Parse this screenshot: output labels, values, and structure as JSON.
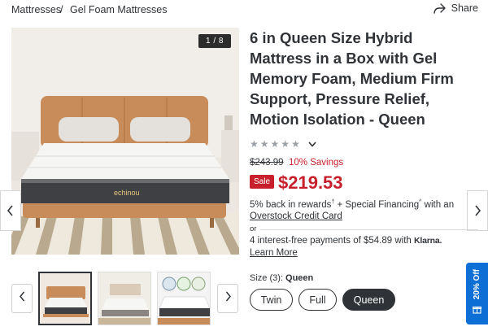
{
  "breadcrumb": {
    "items": [
      "Mattresses",
      "Gel Foam Mattresses"
    ],
    "separator": "/"
  },
  "share": {
    "label": "Share",
    "icon": "share-arrow-icon"
  },
  "gallery": {
    "counter": "1 / 8",
    "brand_mark": "echinou",
    "prev_icon": "chevron-left-icon",
    "next_icon": "chevron-right-icon"
  },
  "thumbnails": {
    "count_visible": 3,
    "selected_index": 0
  },
  "product": {
    "title": "6 in Queen Size Hybrid Mattress in a Box with Gel Memory Foam, Medium Firm Support, Pressure Relief, Motion Isolation - Queen",
    "rating_stars": 0,
    "was_price": "$243.99",
    "savings": "10% Savings",
    "sale_badge": "Sale",
    "price": "$219.53",
    "rewards_text_1": "5% back in rewards",
    "rewards_sup_1": "†",
    "rewards_text_2": " + Special Financing",
    "rewards_sup_2": "^",
    "rewards_text_3": " with an",
    "card_link": "Overstock Credit Card",
    "or": "or",
    "klarna_text": "4 interest-free payments of $54.89 with",
    "klarna_logo": "Klarna.",
    "learn_more": "Learn More"
  },
  "size": {
    "label": "Size (3):",
    "selected": "Queen",
    "options": [
      "Twin",
      "Full",
      "Queen"
    ]
  },
  "offer_tab": {
    "label": "20% Off"
  },
  "colors": {
    "sale_red": "#c7202c",
    "text_dark": "#2f3337",
    "offer_blue": "#0d6fd6"
  }
}
